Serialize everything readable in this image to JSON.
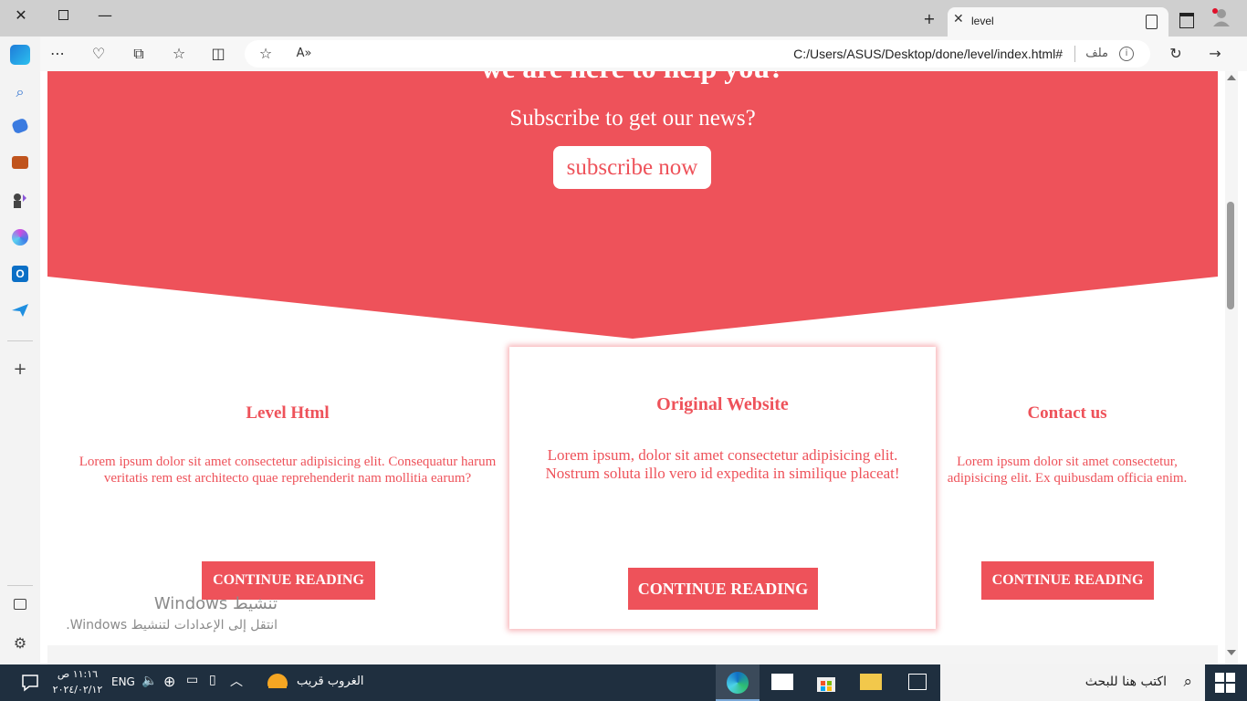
{
  "browser": {
    "tab_title": "level",
    "url": "C:/Users/ASUS/Desktop/done/level/index.html#",
    "file_label": "ملف",
    "accent": "#ee525a"
  },
  "hero": {
    "heading": "we are here to help you?",
    "subtitle": "Subscribe to get our news?",
    "button": "subscribe now",
    "bg_color": "#ee525a"
  },
  "cards": [
    {
      "title": "Level Html",
      "body": "Lorem ipsum dolor sit amet consectetur adipisicing elit. Consequatur harum veritatis rem est architecto quae reprehenderit nam mollitia earum?",
      "button": "CONTINUE READING"
    },
    {
      "title": "Original Website",
      "body": "Lorem ipsum, dolor sit amet consectetur adipisicing elit. Nostrum soluta illo vero id expedita in similique placeat!",
      "button": "CONTINUE READING"
    },
    {
      "title": "Contact us",
      "body": "Lorem ipsum dolor sit amet consectetur, adipisicing elit. Ex quibusdam officia enim.",
      "button": "CONTINUE READING"
    }
  ],
  "watermark": {
    "line1": "تنشيط Windows",
    "line2": "انتقل إلى الإعدادات لتنشيط Windows."
  },
  "taskbar": {
    "search_placeholder": "اكتب هنا للبحث",
    "weather": "الغروب قريب",
    "language": "ENG",
    "time": "١١:١٦ ص",
    "date": "٢٠٢٤/٠٢/١٢"
  }
}
